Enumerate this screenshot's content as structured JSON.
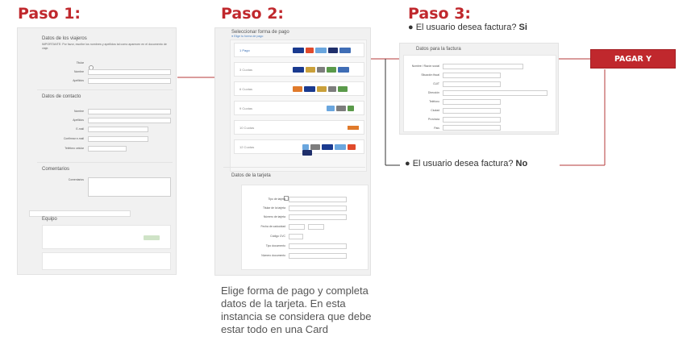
{
  "steps": [
    {
      "title": "Paso 1:"
    },
    {
      "title": "Paso 2:"
    },
    {
      "title": "Paso 3:"
    }
  ],
  "step2": {
    "caption": "Elige forma de pago y completa datos de la tarjeta. En esta instancia se considera que debe estar todo en una Card",
    "panel": {
      "heading": "Seleccionar forma de pago",
      "options": [
        "1 Pago",
        "3 Cuotas",
        "6 Cuotas",
        "9 Cuotas",
        "10 Cuotas",
        "12 Cuotas"
      ],
      "card_section": "Datos de la tarjeta",
      "card_fields": [
        "Tipo de tarjeta",
        "Titular de la tarjeta",
        "Número de tarjeta",
        "Fecha de caducidad",
        "Código CVC",
        "Tipo documento",
        "Número documento"
      ]
    }
  },
  "step1": {
    "panel": {
      "section_passenger": "Datos de los viajeros",
      "section_contact": "Datos de contacto",
      "section_comments": "Comentarios",
      "fields_passenger": [
        "Nombre",
        "Apellidos"
      ],
      "fields_contact": [
        "Nombre",
        "Apellidos",
        "E-mail",
        "Confirmar e-mail",
        "Teléfono celular"
      ],
      "fields_comments": [
        "Comentarios"
      ],
      "section_extra": "Equipo"
    }
  },
  "step3": {
    "bullet_yes_prefix": "El usuario desea factura?",
    "bullet_yes_answer": "Si",
    "bullet_no_prefix": "El usuario desea factura?",
    "bullet_no_answer": "No",
    "button_label": "PAGAR Y RESERVAR",
    "panel": {
      "heading": "Datos para la factura",
      "fields": [
        "Nombre / Razón social",
        "Situación fiscal",
        "CUIT",
        "Dirección",
        "Teléfono",
        "Ciudad",
        "Provincia",
        "País"
      ]
    }
  },
  "colors": {
    "accent": "#c0282d",
    "panel": "#f1f1f1",
    "connector": "#b53a3a"
  }
}
